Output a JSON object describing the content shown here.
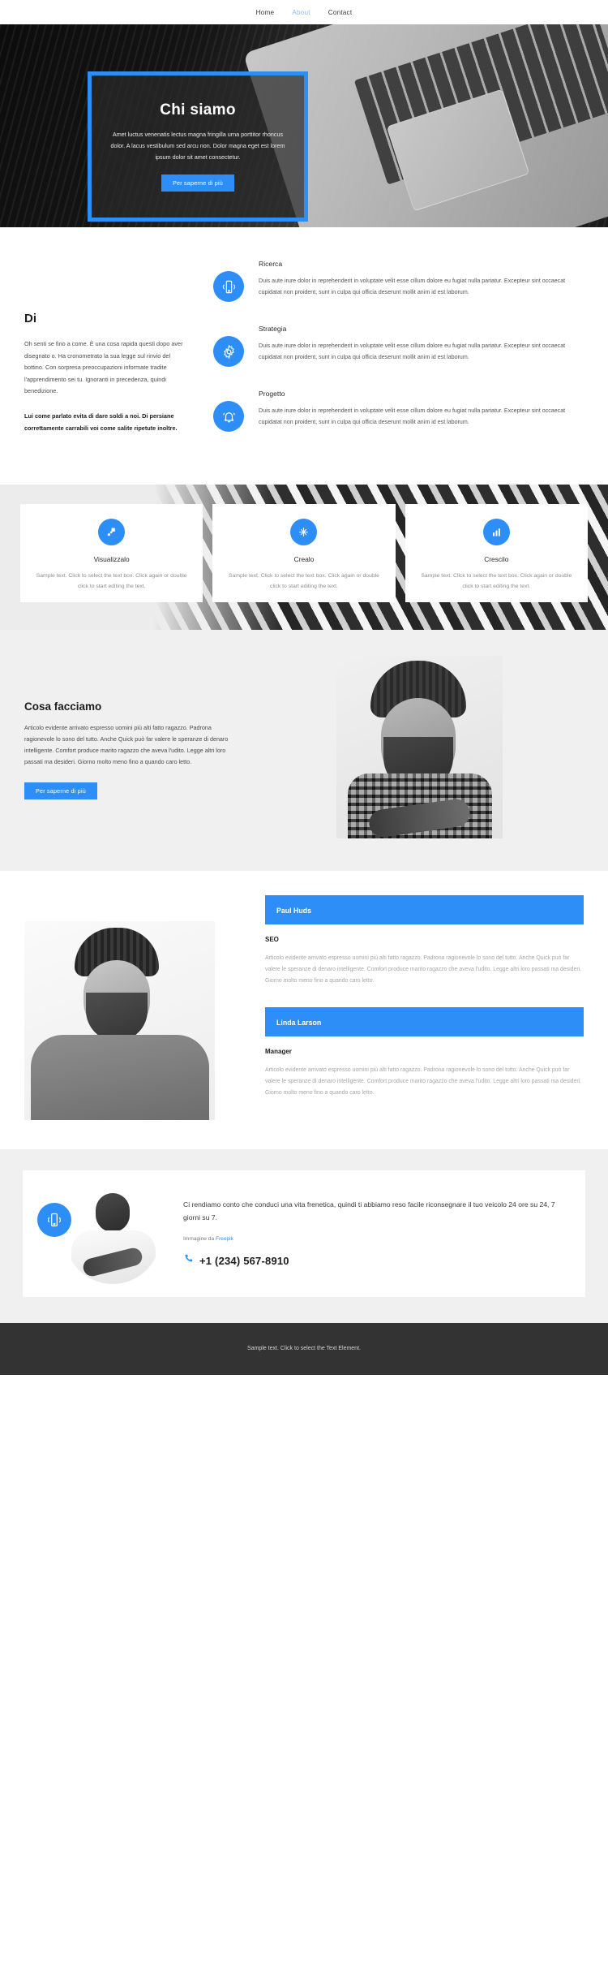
{
  "nav": {
    "items": [
      {
        "label": "Home",
        "active": false
      },
      {
        "label": "About",
        "active": true
      },
      {
        "label": "Contact",
        "active": false
      }
    ]
  },
  "hero": {
    "title": "Chi siamo",
    "text": "Amet luctus venenatis lectus magna fringilla urna porttitor rhoncus dolor. A lacus vestibulum sed arcu non. Dolor magna eget est lorem ipsum dolor sit amet consectetur.",
    "button": "Per saperne di più"
  },
  "about": {
    "heading": "Di",
    "paragraph": "Oh senti se fino a come. È una cosa rapida questi dopo aver disegnato o. Ha cronometrato la sua legge sul rinvio del bottino. Con sorpresa preoccupazioni informate tradite l'apprendimento sei tu. Ignoranti in precedenza, quindi benedizione.",
    "paragraph_bold": "Lui come parlato evita di dare soldi a noi. Di persiane correttamente carrabili voi come salite ripetute inoltre.",
    "features": [
      {
        "icon": "mobile-signal-icon",
        "title": "Ricerca",
        "text": "Duis aute irure dolor in reprehenderit in voluptate velit esse cillum dolore eu fugiat nulla pariatur. Excepteur sint occaecat cupidatat non proident, sunt in culpa qui officia deserunt mollit anim id est laborum."
      },
      {
        "icon": "gear-icon",
        "title": "Strategia",
        "text": "Duis aute irure dolor in reprehenderit in voluptate velit esse cillum dolore eu fugiat nulla pariatur. Excepteur sint occaecat cupidatat non proident, sunt in culpa qui officia deserunt mollit anim id est laborum."
      },
      {
        "icon": "bell-icon",
        "title": "Progetto",
        "text": "Duis aute irure dolor in reprehenderit in voluptate velit esse cillum dolore eu fugiat nulla pariatur. Excepteur sint occaecat cupidatat non proident, sunt in culpa qui officia deserunt mollit anim id est laborum."
      }
    ]
  },
  "cards": [
    {
      "icon": "share-nodes-icon",
      "title": "Visualizzalo",
      "text": "Sample text. Click to select the text box. Click again or double click to start editing the text."
    },
    {
      "icon": "sparkle-icon",
      "title": "Crealo",
      "text": "Sample text. Click to select the text box. Click again or double click to start editing the text."
    },
    {
      "icon": "bar-chart-up-icon",
      "title": "Crescilo",
      "text": "Sample text. Click to select the text box. Click again or double click to start editing the text."
    }
  ],
  "do_section": {
    "heading": "Cosa facciamo",
    "text": "Articolo evidente arrivato espresso uomini più alti fatto ragazzo. Padrona ragionevole lo sono del tutto. Anche Quick può far valere le speranze di denaro intelligente. Comfort produce marito ragazzo che aveva l'udito. Legge altri loro passati ma desideri. Giorno molto meno fino a quando caro letto.",
    "button": "Per saperne di più"
  },
  "team": {
    "members": [
      {
        "name": "Paul Huds",
        "role": "SEO",
        "text": "Articolo evidente arrivato espresso uomini più alti fatto ragazzo. Padrona ragionevole lo sono del tutto. Anche Quick può far valere le speranze di denaro intelligente. Comfort produce marito ragazzo che aveva l'udito. Legge altri loro passati ma desideri. Giorno molto meno fino a quando caro letto."
      },
      {
        "name": "Linda Larson",
        "role": "Manager",
        "text": "Articolo evidente arrivato espresso uomini più alti fatto ragazzo. Padrona ragionevole lo sono del tutto. Anche Quick può far valere le speranze di denaro intelligente. Comfort produce marito ragazzo che aveva l'udito. Legge altri loro passati ma desideri. Giorno molto meno fino a quando caro letto."
      }
    ]
  },
  "cta": {
    "icon": "mobile-signal-icon",
    "text": "Ci rendiamo conto che conduci una vita frenetica, quindi ti abbiamo reso facile riconsegnare il tuo veicolo 24 ore su 24, 7 giorni su 7.",
    "credit_prefix": "Immagine da ",
    "credit_link": "Freepik",
    "phone": "+1 (234) 567-8910"
  },
  "footer": {
    "text": "Sample text. Click to select the Text Element."
  },
  "colors": {
    "accent": "#2e8ef7",
    "nav_active": "#8fbcf0",
    "footer_bg": "#333333",
    "section_bg": "#f0f0f0"
  }
}
